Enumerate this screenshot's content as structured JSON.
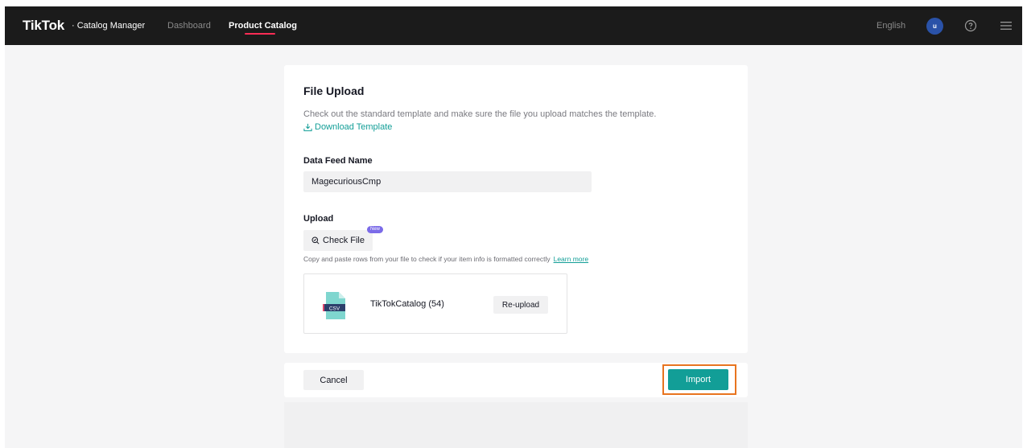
{
  "header": {
    "brand": "TikTok",
    "brand_suffix": "· Catalog Manager",
    "nav": {
      "dashboard": "Dashboard",
      "product_catalog": "Product Catalog"
    },
    "language": "English",
    "avatar_initial": "u",
    "icons": [
      "help-icon",
      "menu-icon"
    ]
  },
  "upload_card": {
    "title": "File Upload",
    "description": "Check out the standard template and make sure the file you upload matches the template.",
    "download_link": "Download Template",
    "feed_label": "Data Feed Name",
    "feed_value": "MagecuriousCmp",
    "upload_label": "Upload",
    "check_file_button": "Check File",
    "new_badge": "New",
    "hint": "Copy and paste rows from your file to check if your item info is formatted correctly",
    "learn_more": "Learn more",
    "file": {
      "icon_text": "CSV",
      "name": "TikTokCatalog (54)",
      "reupload_button": "Re-upload"
    }
  },
  "footer": {
    "cancel_button": "Cancel",
    "import_button": "Import"
  },
  "colors": {
    "accent": "#129e97",
    "highlight": "#e8741f",
    "nav_underline": "#fe2c55",
    "avatar": "#2a52a8",
    "badge": "#7b6be8"
  }
}
